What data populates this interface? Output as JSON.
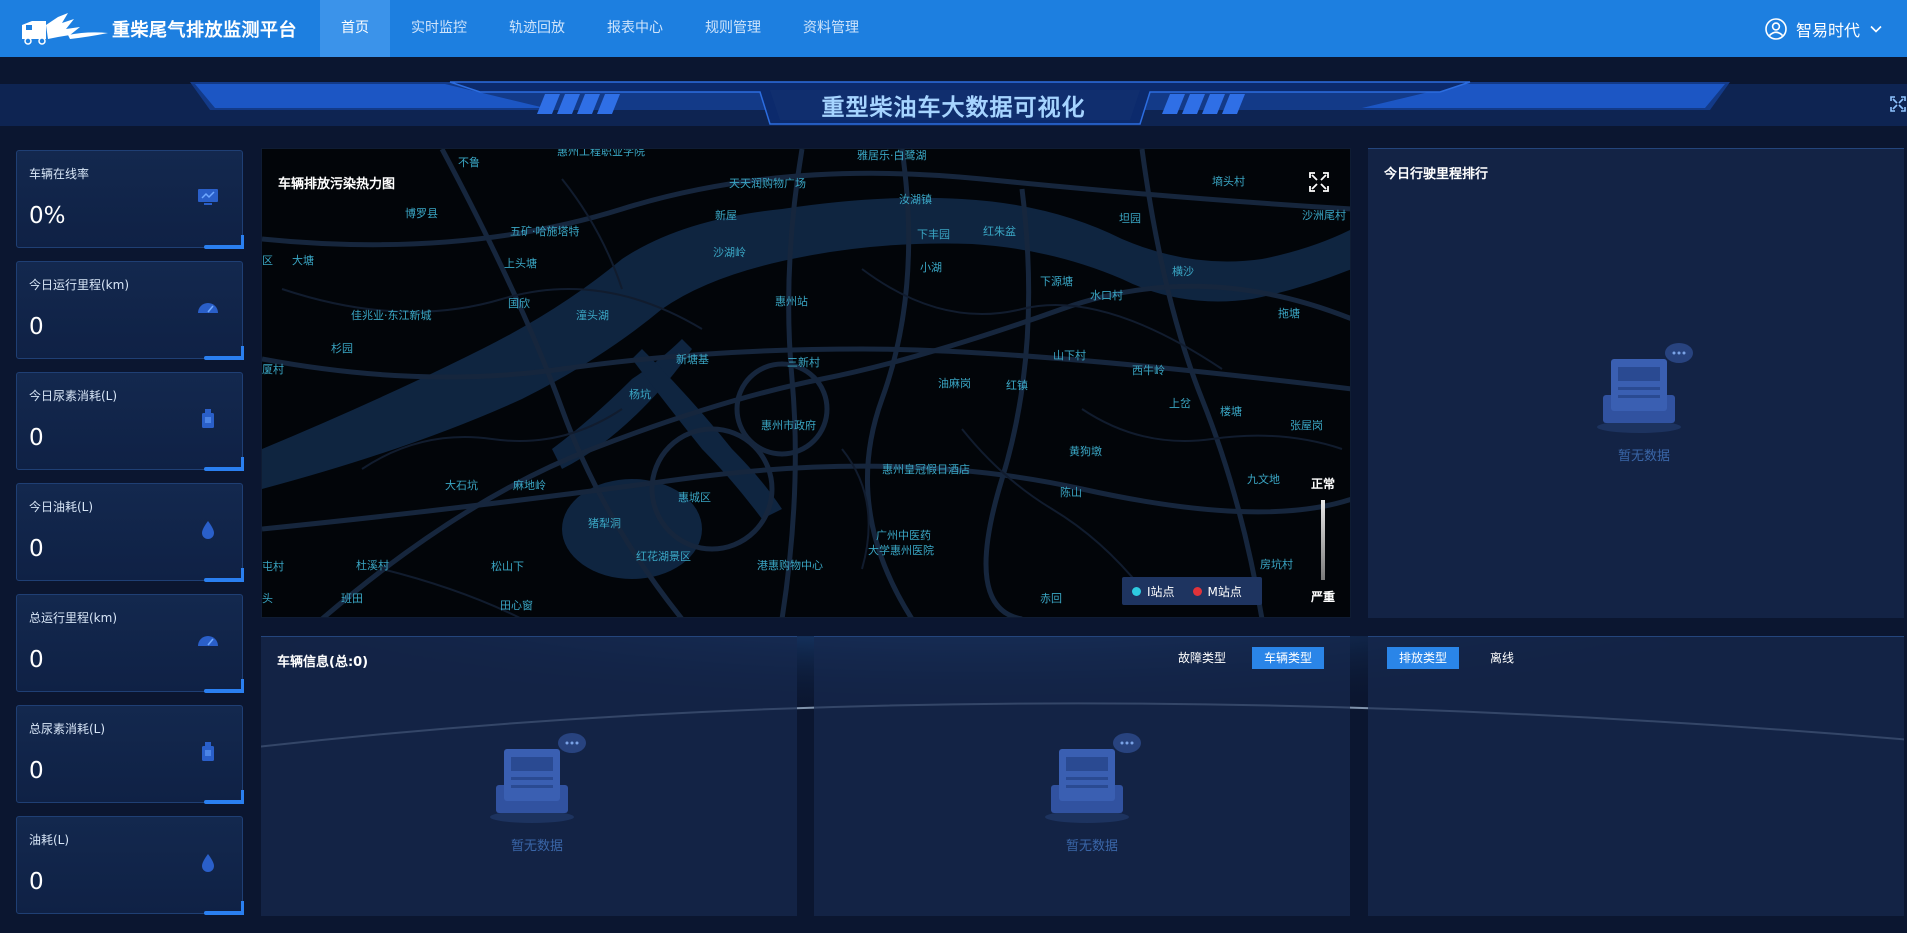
{
  "header": {
    "brand_name": "重柴尾气排放监测平台",
    "nav": [
      "首页",
      "实时监控",
      "轨迹回放",
      "报表中心",
      "规则管理",
      "资料管理"
    ],
    "active_nav": 0,
    "user_name": "智易时代"
  },
  "banner": {
    "title": "重型柴油车大数据可视化"
  },
  "stats": [
    {
      "label": "车辆在线率",
      "value": "0%",
      "icon": "monitor-icon"
    },
    {
      "label": "今日运行里程(km)",
      "value": "0",
      "icon": "speedometer-icon"
    },
    {
      "label": "今日尿素消耗(L)",
      "value": "0",
      "icon": "urea-canister-icon"
    },
    {
      "label": "今日油耗(L)",
      "value": "0",
      "icon": "oil-drop-icon"
    },
    {
      "label": "总运行里程(km)",
      "value": "0",
      "icon": "speedometer-icon"
    },
    {
      "label": "总尿素消耗(L)",
      "value": "0",
      "icon": "urea-canister-icon"
    },
    {
      "label": "油耗(L)",
      "value": "0",
      "icon": "oil-drop-icon"
    }
  ],
  "map": {
    "title": "车辆排放污染热力图",
    "scale_top": "正常",
    "scale_bottom": "严重",
    "legend": [
      {
        "label": "I站点",
        "color": "#2ecbe0"
      },
      {
        "label": "M站点",
        "color": "#e0333a"
      }
    ],
    "places": [
      "惠州工程职业学院",
      "不鲁",
      "雅居乐·白鹭湖",
      "天天润购物广场",
      "墒头村",
      "博罗县",
      "五矿·哈施塔特",
      "新屋",
      "汝湖镇",
      "坦园",
      "沙洲尾村",
      "区",
      "大塘",
      "上头塘",
      "沙湖岭",
      "下丰园",
      "红朱盆",
      "小湖",
      "横沙",
      "下源塘",
      "水口村",
      "佳兆业·东江新城",
      "国欣",
      "潼头湖",
      "惠州站",
      "拖塘",
      "杉园",
      "新塘基",
      "三新村",
      "山下村",
      "厦村",
      "杨坑",
      "油麻岗",
      "红镇",
      "西牛岭",
      "上岔",
      "楼塘",
      "张屋岗",
      "惠州市政府",
      "黄狗墩",
      "惠州皇冠假日酒店",
      "大石坑",
      "麻地岭",
      "惠城区",
      "陈山",
      "九文地",
      "猪犁洞",
      "广州中医药",
      "大学惠州医院",
      "屯村",
      "杜溪村",
      "松山下",
      "红花湖景区",
      "港惠购物中心",
      "房坑村",
      "头",
      "班田",
      "田心窗",
      "赤回"
    ]
  },
  "ranking": {
    "title": "今日行驶里程排行",
    "empty": "暂无数据"
  },
  "vehicle": {
    "title": "车辆信息(总:0)",
    "empty": "暂无数据"
  },
  "fault": {
    "tabs": [
      "故障类型",
      "车辆类型"
    ],
    "active": 1,
    "empty": "暂无数据"
  },
  "emission": {
    "tabs": [
      "排放类型",
      "离线"
    ],
    "active": 0
  }
}
